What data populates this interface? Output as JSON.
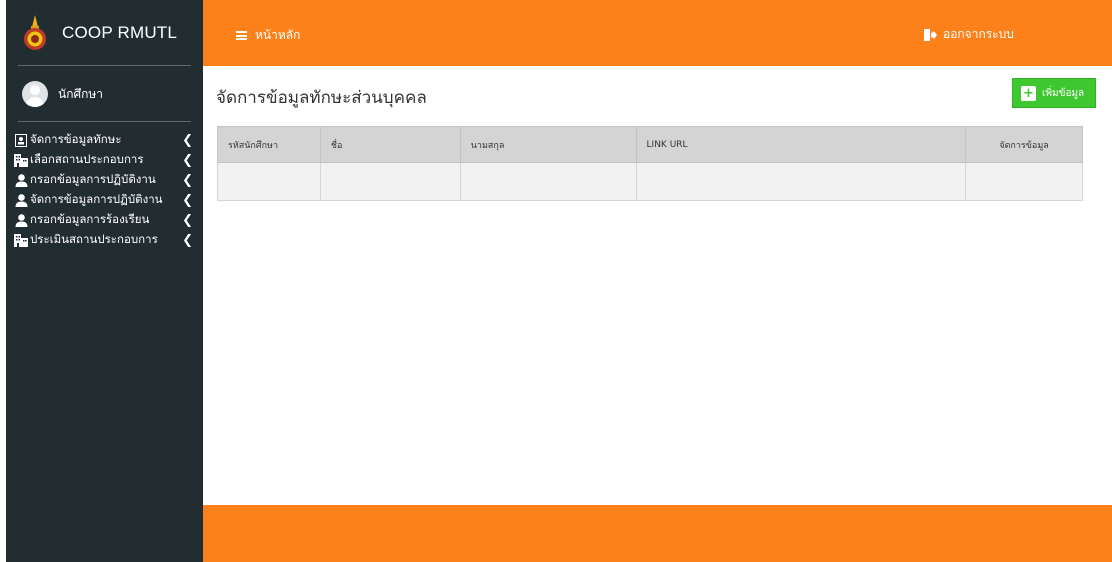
{
  "brand": {
    "title": "COOP RMUTL"
  },
  "user": {
    "name": "นักศึกษา"
  },
  "sidebar": {
    "items": [
      {
        "label": "จัดการข้อมูลทักษะ",
        "icon": "id-card-icon"
      },
      {
        "label": "เลือกสถานประกอบการ",
        "icon": "building-icon"
      },
      {
        "label": "กรอกข้อมูลการปฏิบัติงาน",
        "icon": "user-icon"
      },
      {
        "label": "จัดการข้อมูลการปฏิบัติงาน",
        "icon": "user-icon"
      },
      {
        "label": "กรอกข้อมูลการร้องเรียน",
        "icon": "user-icon"
      },
      {
        "label": "ประเมินสถานประกอบการ",
        "icon": "building-icon"
      }
    ]
  },
  "topbar": {
    "home_label": "หน้าหลัก",
    "logout_label": "ออกจากระบบ"
  },
  "main": {
    "title": "จัดการข้อมูลทักษะส่วนบุคคล",
    "add_label": "เพิ่มข้อมูล"
  },
  "table": {
    "columns": [
      "รหัสนักศึกษา",
      "ชื่อ",
      "นามสกุล",
      "LINK URL",
      "จัดการข้อมูล"
    ],
    "rows": [
      [
        "",
        "",
        "",
        "",
        ""
      ]
    ]
  },
  "colors": {
    "accent": "#fd811a",
    "sidebar": "#222d32",
    "add_button": "#3ec72f"
  }
}
